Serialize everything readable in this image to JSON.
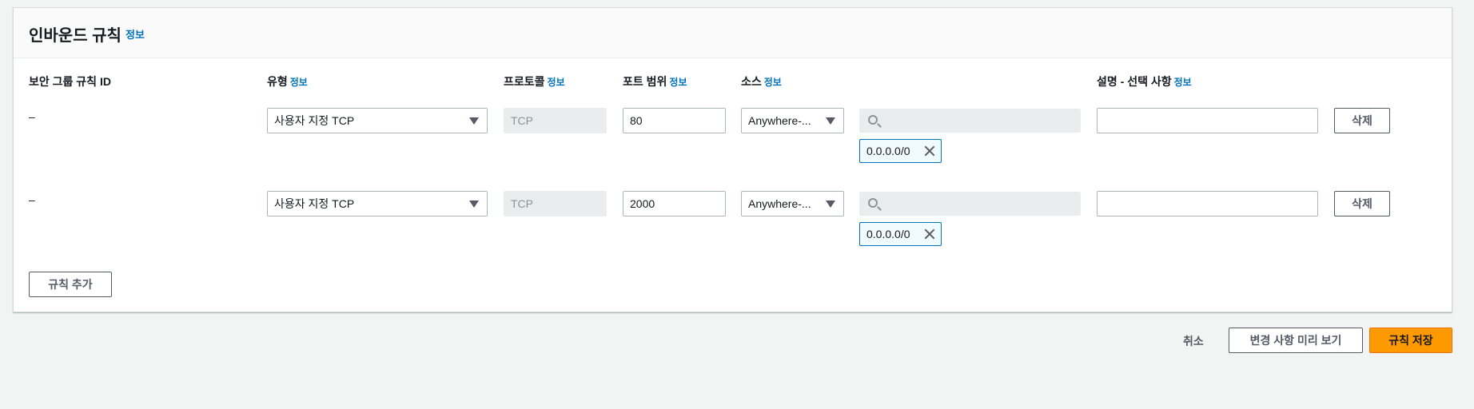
{
  "panel": {
    "title": "인바운드 규칙",
    "title_info": "정보"
  },
  "columns": {
    "rule_id": "보안 그룹 규칙 ID",
    "type": "유형",
    "type_info": "정보",
    "protocol": "프로토콜",
    "protocol_info": "정보",
    "port_range": "포트 범위",
    "port_range_info": "정보",
    "source": "소스",
    "source_info": "정보",
    "description": "설명 - 선택 사항",
    "description_info": "정보"
  },
  "rules": [
    {
      "rule_id": "–",
      "type": "사용자 지정 TCP",
      "protocol": "TCP",
      "port_range": "80",
      "source": "Anywhere-...",
      "search_placeholder": "",
      "cidr_token": "0.0.0.0/0",
      "description": "",
      "delete_label": "삭제"
    },
    {
      "rule_id": "–",
      "type": "사용자 지정 TCP",
      "protocol": "TCP",
      "port_range": "2000",
      "source": "Anywhere-...",
      "search_placeholder": "",
      "cidr_token": "0.0.0.0/0",
      "description": "",
      "delete_label": "삭제"
    }
  ],
  "add_rule_label": "규칙 추가",
  "footer": {
    "cancel_label": "취소",
    "preview_label": "변경 사항 미리 보기",
    "save_label": "규칙 저장"
  },
  "colors": {
    "link": "#0073bb",
    "primary": "#ff9900",
    "token_border": "#0073bb"
  }
}
